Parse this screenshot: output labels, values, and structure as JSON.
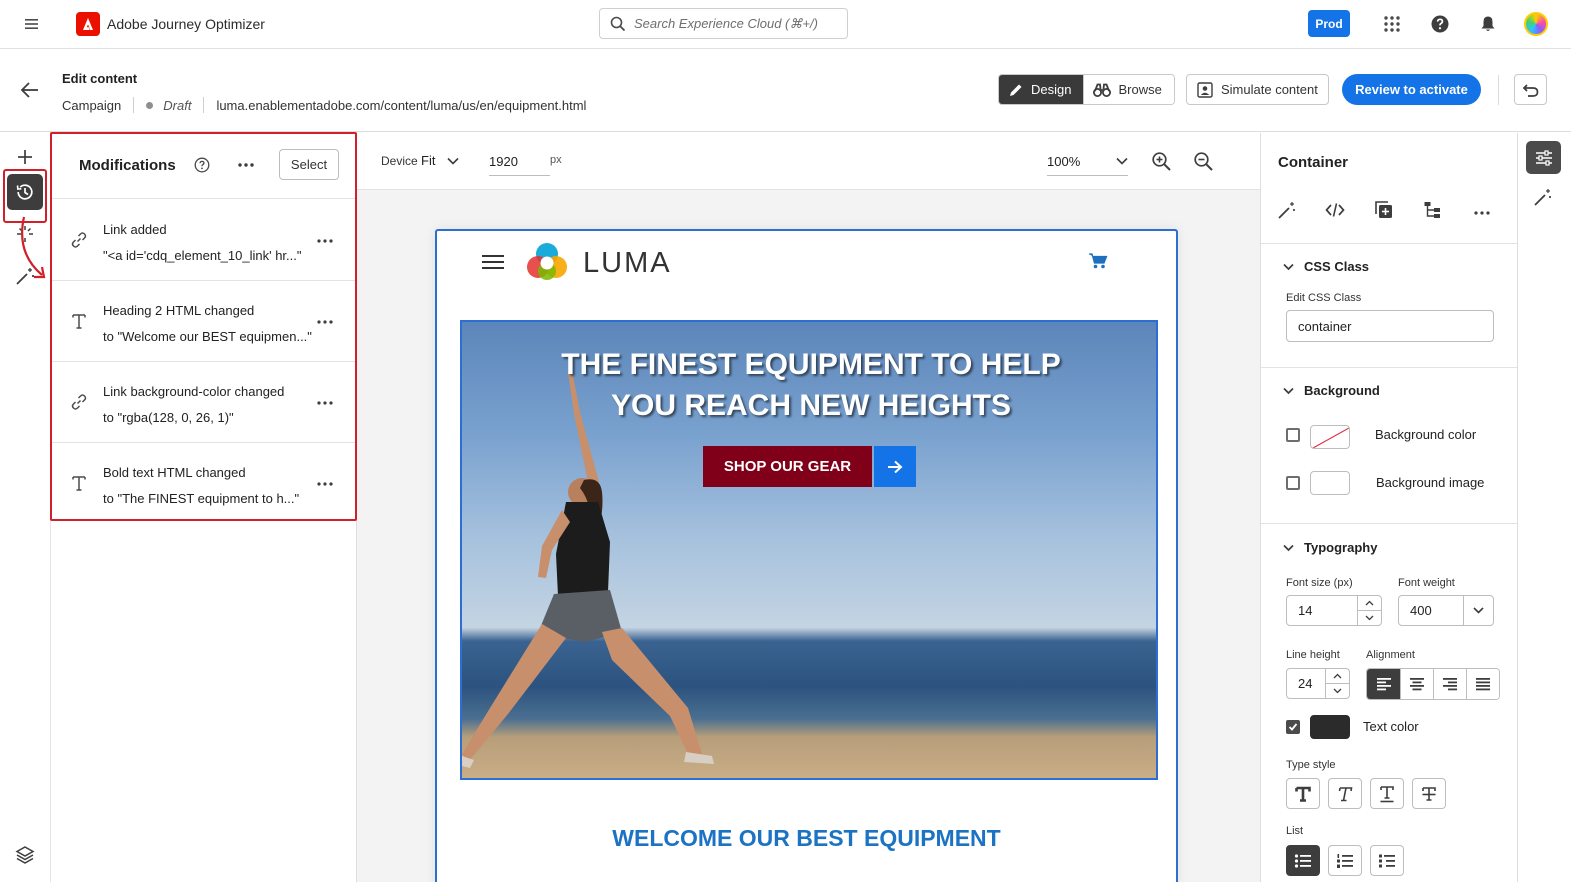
{
  "app": {
    "title": "Adobe Journey Optimizer"
  },
  "search": {
    "placeholder": "Search Experience Cloud (⌘+/)"
  },
  "topbar": {
    "environment": "Prod"
  },
  "header": {
    "title": "Edit content",
    "type": "Campaign",
    "status": "Draft",
    "url": "luma.enablementadobe.com/content/luma/us/en/equipment.html",
    "design_label": "Design",
    "browse_label": "Browse",
    "simulate_label": "Simulate content",
    "review_label": "Review to activate"
  },
  "modifications": {
    "title": "Modifications",
    "select_label": "Select",
    "items": [
      {
        "title": "Link added",
        "detail": "\"<a id='cdq_element_10_link' hr...\"",
        "icon": "link-icon"
      },
      {
        "title": "Heading 2 HTML changed",
        "detail": "to \"Welcome our BEST equipmen...\"",
        "icon": "text-icon"
      },
      {
        "title": "Link background-color changed",
        "detail": "to \"rgba(128, 0, 26, 1)\"",
        "icon": "link-icon"
      },
      {
        "title": "Bold text HTML changed",
        "detail": "to \"The FINEST equipment to h...\"",
        "icon": "text-icon"
      }
    ]
  },
  "canvas": {
    "device_label": "Device",
    "device_value": "Fit",
    "width_value": "1920",
    "width_unit": "px",
    "zoom_value": "100%"
  },
  "preview": {
    "brand": "LUMA",
    "headline_line1": "The FINEST equipment to help",
    "headline_line2": "you reach new heights",
    "cta_label": "SHOP OUR GEAR",
    "welcome": "WELCOME OUR BEST EQUIPMENT"
  },
  "properties": {
    "title": "Container",
    "css_section": "CSS Class",
    "css_label": "Edit CSS Class",
    "css_value": "container",
    "background_section": "Background",
    "bg_color_label": "Background color",
    "bg_image_label": "Background image",
    "typography_section": "Typography",
    "font_size_label": "Font size (px)",
    "font_size_value": "14",
    "font_weight_label": "Font weight",
    "font_weight_value": "400",
    "line_height_label": "Line height",
    "line_height_value": "24",
    "alignment_label": "Alignment",
    "text_color_label": "Text color",
    "type_style_label": "Type style",
    "list_label": "List"
  },
  "colors": {
    "accent": "#1473e6",
    "annotation": "#d0202a",
    "cta": "#80001a",
    "text_color_swatch": "#2b2b2b",
    "welcome_blue": "#1c73c4"
  }
}
